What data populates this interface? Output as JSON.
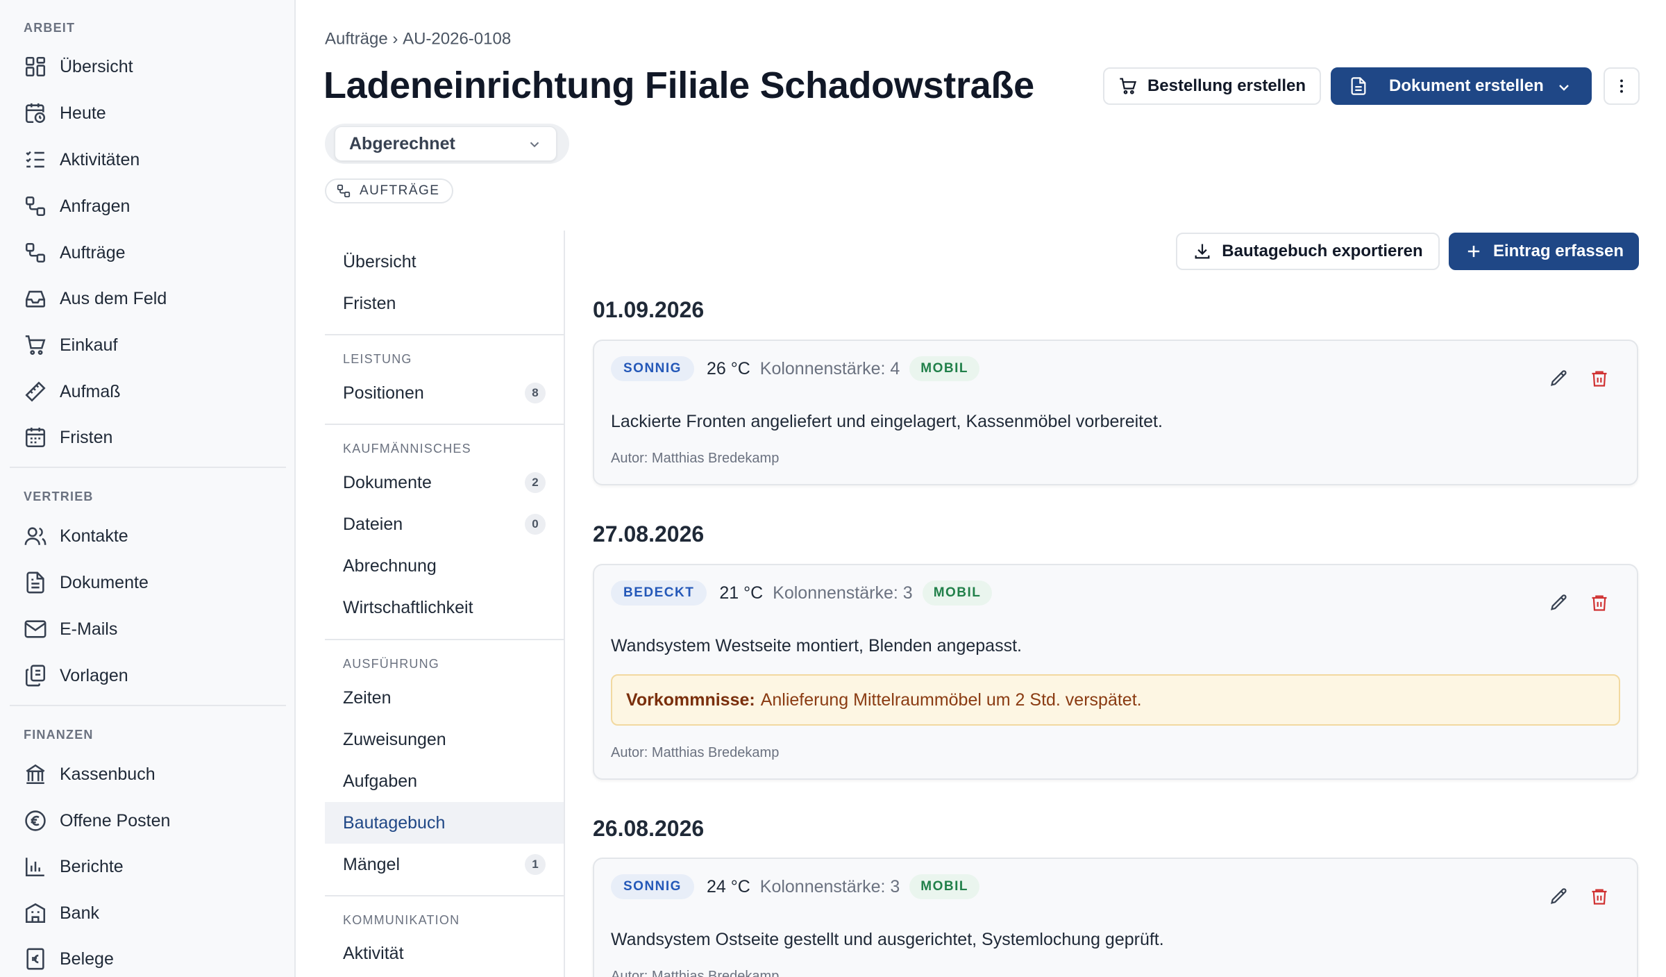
{
  "sidebar": {
    "sections": [
      {
        "title": "ARBEIT",
        "items": [
          {
            "label": "Übersicht",
            "icon": "dashboard-icon"
          },
          {
            "label": "Heute",
            "icon": "calendar-clock-icon"
          },
          {
            "label": "Aktivitäten",
            "icon": "checklist-icon"
          },
          {
            "label": "Anfragen",
            "icon": "workflow-icon"
          },
          {
            "label": "Aufträge",
            "icon": "workflow-icon"
          },
          {
            "label": "Aus dem Feld",
            "icon": "inbox-icon"
          },
          {
            "label": "Einkauf",
            "icon": "cart-icon"
          },
          {
            "label": "Aufmaß",
            "icon": "ruler-icon"
          },
          {
            "label": "Fristen",
            "icon": "calendar-icon"
          }
        ]
      },
      {
        "title": "VERTRIEB",
        "items": [
          {
            "label": "Kontakte",
            "icon": "users-icon"
          },
          {
            "label": "Dokumente",
            "icon": "document-icon"
          },
          {
            "label": "E-Mails",
            "icon": "mail-icon"
          },
          {
            "label": "Vorlagen",
            "icon": "copy-icon"
          }
        ]
      },
      {
        "title": "FINANZEN",
        "items": [
          {
            "label": "Kassenbuch",
            "icon": "bank-icon"
          },
          {
            "label": "Offene Posten",
            "icon": "euro-circle-icon"
          },
          {
            "label": "Berichte",
            "icon": "bar-chart-icon"
          },
          {
            "label": "Bank",
            "icon": "building-icon"
          },
          {
            "label": "Belege",
            "icon": "receipt-icon"
          }
        ]
      }
    ]
  },
  "breadcrumb": {
    "parent": "Aufträge",
    "separator": "›",
    "current": "AU-2026-0108"
  },
  "header": {
    "title": "Ladeneinrichtung Filiale Schadowstraße",
    "order_button": "Bestellung erstellen",
    "document_button": "Dokument erstellen",
    "status": "Abgerechnet",
    "tag": "AUFTRÄGE"
  },
  "subnav": {
    "items_top": [
      {
        "label": "Übersicht"
      },
      {
        "label": "Fristen"
      }
    ],
    "sections": [
      {
        "title": "LEISTUNG",
        "items": [
          {
            "label": "Positionen",
            "badge": "8"
          }
        ]
      },
      {
        "title": "KAUFMÄNNISCHES",
        "items": [
          {
            "label": "Dokumente",
            "badge": "2"
          },
          {
            "label": "Dateien",
            "badge": "0"
          },
          {
            "label": "Abrechnung"
          },
          {
            "label": "Wirtschaftlichkeit"
          }
        ]
      },
      {
        "title": "AUSFÜHRUNG",
        "items": [
          {
            "label": "Zeiten"
          },
          {
            "label": "Zuweisungen"
          },
          {
            "label": "Aufgaben"
          },
          {
            "label": "Bautagebuch",
            "active": true
          },
          {
            "label": "Mängel",
            "badge": "1"
          }
        ]
      },
      {
        "title": "KOMMUNIKATION",
        "items": [
          {
            "label": "Aktivität"
          }
        ]
      }
    ]
  },
  "toolbar": {
    "export_button": "Bautagebuch exportieren",
    "add_button": "Eintrag erfassen"
  },
  "entries": [
    {
      "date": "01.09.2026",
      "weather": "SONNIG",
      "temperature": "26 °C",
      "crew": "Kolonnenstärke: 4",
      "mobility": "MOBIL",
      "text": "Lackierte Fronten angeliefert und eingelagert, Kassenmöbel vorbereitet.",
      "author": "Autor: Matthias Bredekamp"
    },
    {
      "date": "27.08.2026",
      "weather": "BEDECKT",
      "temperature": "21 °C",
      "crew": "Kolonnenstärke: 3",
      "mobility": "MOBIL",
      "text": "Wandsystem Westseite montiert, Blenden angepasst.",
      "incident_label": "Vorkommnisse:",
      "incident_text": "Anlieferung Mittelraummöbel um 2 Std. verspätet.",
      "author": "Autor: Matthias Bredekamp"
    },
    {
      "date": "26.08.2026",
      "weather": "SONNIG",
      "temperature": "24 °C",
      "crew": "Kolonnenstärke: 3",
      "mobility": "MOBIL",
      "text": "Wandsystem Ostseite gestellt und ausgerichtet, Systemlochung geprüft.",
      "author": "Autor: Matthias Bredekamp"
    }
  ],
  "colors": {
    "primary": "#1f4786",
    "weather_badge": "#2458b8",
    "mobil_badge": "#21804a",
    "delete": "#d03232",
    "incident_bg": "#fdf6e3"
  }
}
